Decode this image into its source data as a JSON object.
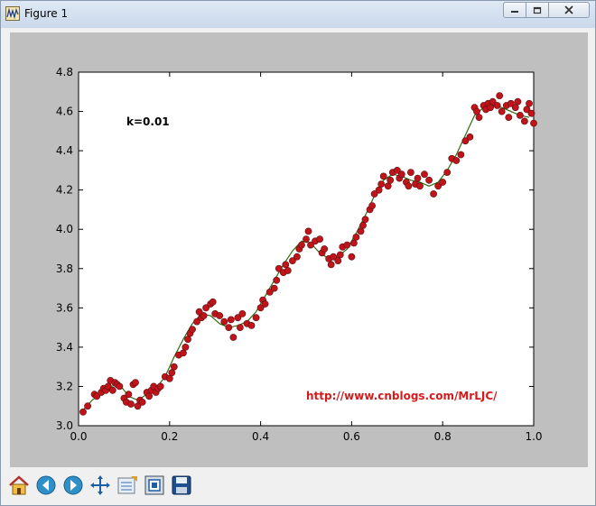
{
  "window": {
    "title": "Figure 1"
  },
  "toolbar": {
    "icons": [
      "home-icon",
      "back-icon",
      "forward-icon",
      "pan-icon",
      "subplots-icon",
      "zoom-icon",
      "save-icon"
    ]
  },
  "chart_data": {
    "type": "scatter",
    "annotation": "k=0.01",
    "watermark": "http://www.cnblogs.com/MrLJC/",
    "xlim": [
      0.0,
      1.0
    ],
    "ylim": [
      3.0,
      4.8
    ],
    "x_ticks": [
      "0.0",
      "0.2",
      "0.4",
      "0.6",
      "0.8",
      "1.0"
    ],
    "y_ticks": [
      "3.0",
      "3.2",
      "3.4",
      "3.6",
      "3.8",
      "4.0",
      "4.2",
      "4.4",
      "4.6",
      "4.8"
    ],
    "grid": false,
    "colors": {
      "points": "#c0141a",
      "line": "#2e6b12",
      "watermark": "#d21c1c"
    },
    "fit_line": {
      "x": [
        0.01,
        0.03,
        0.05,
        0.07,
        0.09,
        0.11,
        0.13,
        0.15,
        0.17,
        0.19,
        0.21,
        0.23,
        0.25,
        0.27,
        0.29,
        0.31,
        0.33,
        0.35,
        0.37,
        0.39,
        0.41,
        0.43,
        0.45,
        0.47,
        0.49,
        0.51,
        0.53,
        0.55,
        0.57,
        0.59,
        0.61,
        0.63,
        0.65,
        0.67,
        0.69,
        0.71,
        0.73,
        0.75,
        0.77,
        0.79,
        0.81,
        0.83,
        0.85,
        0.87,
        0.89,
        0.91,
        0.93,
        0.95,
        0.97,
        0.99
      ],
      "y": [
        3.08,
        3.13,
        3.17,
        3.2,
        3.21,
        3.15,
        3.13,
        3.16,
        3.19,
        3.25,
        3.35,
        3.44,
        3.52,
        3.57,
        3.56,
        3.52,
        3.5,
        3.51,
        3.53,
        3.58,
        3.66,
        3.74,
        3.82,
        3.89,
        3.94,
        3.93,
        3.88,
        3.85,
        3.86,
        3.9,
        3.98,
        4.07,
        4.17,
        4.25,
        4.28,
        4.27,
        4.25,
        4.24,
        4.22,
        4.24,
        4.3,
        4.38,
        4.48,
        4.58,
        4.62,
        4.63,
        4.62,
        4.6,
        4.58,
        4.57
      ]
    },
    "points": {
      "x": [
        0.01,
        0.02,
        0.035,
        0.04,
        0.05,
        0.055,
        0.06,
        0.065,
        0.07,
        0.075,
        0.08,
        0.085,
        0.09,
        0.1,
        0.105,
        0.11,
        0.115,
        0.12,
        0.125,
        0.13,
        0.135,
        0.14,
        0.15,
        0.155,
        0.16,
        0.165,
        0.17,
        0.175,
        0.18,
        0.19,
        0.2,
        0.205,
        0.21,
        0.22,
        0.23,
        0.235,
        0.24,
        0.245,
        0.25,
        0.26,
        0.265,
        0.27,
        0.275,
        0.28,
        0.29,
        0.295,
        0.3,
        0.31,
        0.32,
        0.33,
        0.335,
        0.34,
        0.35,
        0.355,
        0.36,
        0.37,
        0.38,
        0.39,
        0.4,
        0.405,
        0.41,
        0.42,
        0.43,
        0.435,
        0.44,
        0.45,
        0.455,
        0.46,
        0.47,
        0.48,
        0.485,
        0.49,
        0.5,
        0.505,
        0.51,
        0.52,
        0.53,
        0.535,
        0.54,
        0.55,
        0.555,
        0.56,
        0.57,
        0.575,
        0.58,
        0.59,
        0.6,
        0.605,
        0.61,
        0.62,
        0.625,
        0.63,
        0.64,
        0.645,
        0.65,
        0.66,
        0.665,
        0.67,
        0.68,
        0.685,
        0.69,
        0.7,
        0.705,
        0.71,
        0.72,
        0.725,
        0.73,
        0.74,
        0.745,
        0.75,
        0.76,
        0.77,
        0.78,
        0.79,
        0.8,
        0.81,
        0.82,
        0.83,
        0.84,
        0.85,
        0.86,
        0.87,
        0.875,
        0.88,
        0.89,
        0.895,
        0.9,
        0.905,
        0.91,
        0.92,
        0.925,
        0.93,
        0.94,
        0.945,
        0.95,
        0.96,
        0.965,
        0.97,
        0.98,
        0.985,
        0.99,
        0.995,
        1.0
      ],
      "y": [
        3.07,
        3.1,
        3.16,
        3.15,
        3.17,
        3.19,
        3.18,
        3.2,
        3.23,
        3.18,
        3.22,
        3.21,
        3.2,
        3.14,
        3.12,
        3.16,
        3.11,
        3.21,
        3.22,
        3.1,
        3.13,
        3.12,
        3.17,
        3.15,
        3.18,
        3.2,
        3.17,
        3.19,
        3.2,
        3.25,
        3.24,
        3.27,
        3.3,
        3.36,
        3.37,
        3.4,
        3.44,
        3.47,
        3.49,
        3.53,
        3.58,
        3.55,
        3.56,
        3.6,
        3.62,
        3.63,
        3.57,
        3.56,
        3.53,
        3.5,
        3.54,
        3.45,
        3.55,
        3.5,
        3.57,
        3.52,
        3.51,
        3.55,
        3.6,
        3.64,
        3.62,
        3.68,
        3.7,
        3.74,
        3.8,
        3.78,
        3.82,
        3.79,
        3.84,
        3.86,
        3.9,
        3.92,
        3.95,
        3.99,
        3.92,
        3.94,
        3.95,
        3.88,
        3.9,
        3.85,
        3.82,
        3.86,
        3.84,
        3.87,
        3.91,
        3.92,
        3.86,
        3.93,
        3.96,
        3.99,
        4.02,
        4.05,
        4.1,
        4.12,
        4.18,
        4.2,
        4.23,
        4.27,
        4.22,
        4.25,
        4.29,
        4.3,
        4.26,
        4.28,
        4.24,
        4.22,
        4.29,
        4.23,
        4.26,
        4.22,
        4.28,
        4.25,
        4.18,
        4.22,
        4.24,
        4.29,
        4.36,
        4.35,
        4.38,
        4.45,
        4.47,
        4.62,
        4.6,
        4.57,
        4.63,
        4.61,
        4.64,
        4.62,
        4.65,
        4.63,
        4.68,
        4.6,
        4.63,
        4.57,
        4.64,
        4.62,
        4.65,
        4.58,
        4.55,
        4.61,
        4.64,
        4.59,
        4.54,
        4.57,
        4.53
      ]
    }
  }
}
